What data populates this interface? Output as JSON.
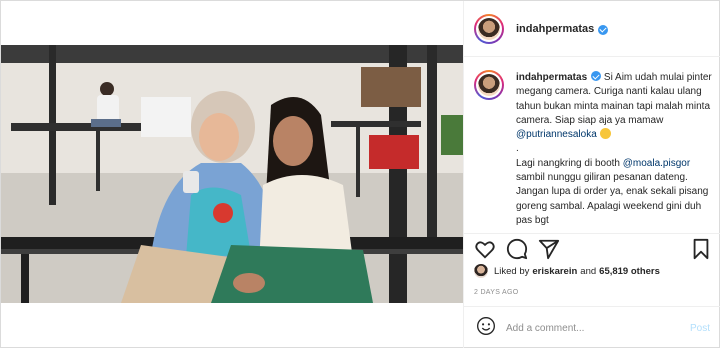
{
  "post": {
    "username": "indahpermatas",
    "verified": true,
    "caption": {
      "username": "indahpermatas",
      "line1": " Si Aim udah mulai pinter megang camera. Curiga nanti kalau ulang tahun bukan minta mainan tapi malah minta camera. Siap siap aja ya mamaw ",
      "mention1": "@putriannesaloka",
      "dot": ".",
      "line2": "Lagi nangkring di booth ",
      "mention2": "@moala.pisgor",
      "line3": " sambil nunggu giliran pesanan dateng. Jangan lupa di order ya, enak sekali pisang goreng sambal. Apalagi weekend gini duh pas bgt"
    },
    "likes": {
      "prefix": "Liked by",
      "user": "eriskarein",
      "and": "and",
      "count": "65,819 others"
    },
    "timestamp": "2 DAYS AGO",
    "comment": {
      "placeholder": "Add a comment...",
      "post_label": "Post"
    }
  },
  "icons": {
    "like": "heart-icon",
    "comment": "comment-icon",
    "share": "send-icon",
    "save": "bookmark-icon",
    "emoji": "smile-icon",
    "verified": "verified-badge-icon"
  },
  "colors": {
    "link": "#00376b",
    "verified": "#3897f0",
    "post_disabled": "#b2dffc",
    "muted": "#8e8e8e"
  }
}
